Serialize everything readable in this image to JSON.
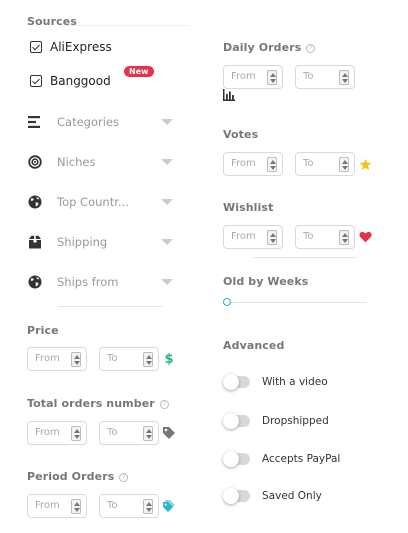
{
  "sources": {
    "title": "Sources",
    "items": [
      {
        "label": "AliExpress"
      },
      {
        "label": "Banggood",
        "badge": "New"
      }
    ]
  },
  "dropdowns": [
    {
      "label": "Categories",
      "icon": "list-icon"
    },
    {
      "label": "Niches",
      "icon": "target-icon"
    },
    {
      "label": "Top Countr...",
      "icon": "globe-icon"
    },
    {
      "label": "Shipping",
      "icon": "box-icon"
    },
    {
      "label": "Ships from",
      "icon": "globe-icon"
    }
  ],
  "price": {
    "title": "Price",
    "from": "From",
    "to": "To",
    "icon": "dollar-icon"
  },
  "total_orders": {
    "title": "Total orders number",
    "from": "From",
    "to": "To",
    "icon": "tag-icon"
  },
  "period_orders": {
    "title": "Period Orders",
    "from": "From",
    "to": "To",
    "icon": "tags-icon"
  },
  "daily_orders": {
    "title": "Daily Orders",
    "from": "From",
    "to": "To",
    "icon": "bar-chart-icon"
  },
  "votes": {
    "title": "Votes",
    "from": "From",
    "to": "To",
    "icon": "star-icon"
  },
  "wishlist": {
    "title": "Wishlist",
    "from": "From",
    "to": "To",
    "icon": "heart-icon"
  },
  "old_by_weeks": {
    "title": "Old by Weeks"
  },
  "advanced": {
    "title": "Advanced",
    "toggles": [
      {
        "label": "With a video"
      },
      {
        "label": "Dropshipped"
      },
      {
        "label": "Accepts PayPal"
      },
      {
        "label": "Saved Only"
      }
    ]
  },
  "colors": {
    "accent": "#29b6c8",
    "star": "#f5c518",
    "heart": "#e6314b",
    "dollar": "#1fb87a",
    "badge": "#e6314b"
  }
}
